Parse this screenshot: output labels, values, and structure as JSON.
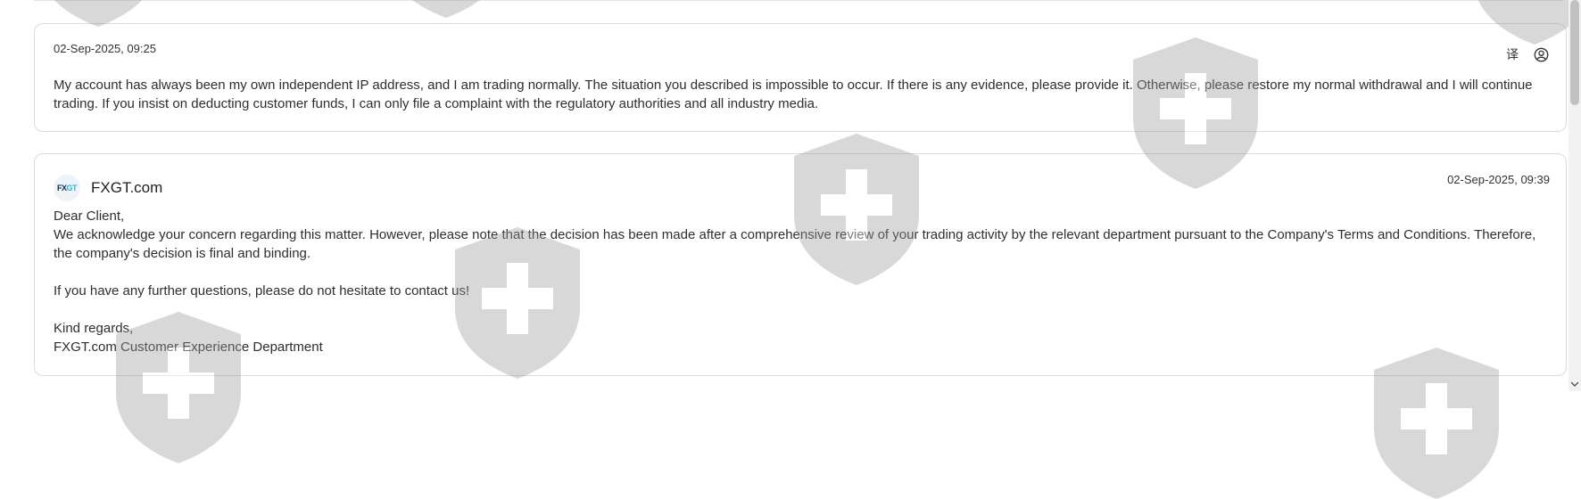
{
  "messages": [
    {
      "timestamp": "02-Sep-2025, 09:25",
      "icons": [
        "translate-icon",
        "user-circle-icon"
      ],
      "body": [
        "My account has always been my own independent IP address, and I am trading normally. The situation you described is impossible to occur. If there is any evidence, please provide it. Otherwise, please restore my normal withdrawal and I will continue trading. If you insist on deducting customer funds, I can only file a complaint with the regulatory authorities and all industry media."
      ]
    },
    {
      "sender": "FXGT.com",
      "avatar_text": {
        "part1": "FX",
        "part2": "GT"
      },
      "timestamp": "02-Sep-2025, 09:39",
      "body": [
        "Dear Client,",
        "We acknowledge your concern regarding this matter. However, please note that the decision has been made after a comprehensive review of your trading activity by the relevant department pursuant to the Company's Terms and Conditions. Therefore, the company's decision is final and binding.",
        "",
        "If you have any further questions, please do not hesitate to contact us!",
        "",
        "Kind regards,",
        "FXGT.com Customer Experience Department"
      ]
    }
  ],
  "translate_glyph": "译",
  "colors": {
    "accent": "#26b8d8",
    "brand_dark": "#0f2a4a",
    "watermark": "#9a9a9a"
  }
}
